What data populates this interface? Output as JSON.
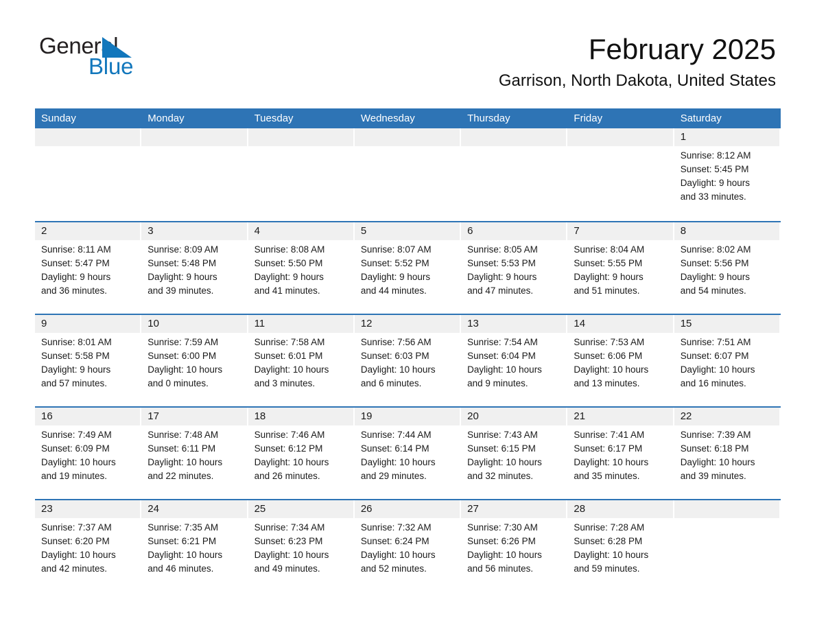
{
  "brand": {
    "name_part1": "General",
    "name_part2": "Blue",
    "triangle_color": "#1277bc",
    "text_color": "#231f20"
  },
  "header": {
    "title": "February 2025",
    "subtitle": "Garrison, North Dakota, United States"
  },
  "colors": {
    "header_blue": "#2e74b5",
    "day_band_gray": "#f0f0f0",
    "text": "#1a1a1a"
  },
  "weekday_headers": [
    "Sunday",
    "Monday",
    "Tuesday",
    "Wednesday",
    "Thursday",
    "Friday",
    "Saturday"
  ],
  "weeks": [
    [
      {
        "empty": true
      },
      {
        "empty": true
      },
      {
        "empty": true
      },
      {
        "empty": true
      },
      {
        "empty": true
      },
      {
        "empty": true
      },
      {
        "day": "1",
        "sunrise": "Sunrise: 8:12 AM",
        "sunset": "Sunset: 5:45 PM",
        "daylight_line1": "Daylight: 9 hours",
        "daylight_line2": "and 33 minutes."
      }
    ],
    [
      {
        "day": "2",
        "sunrise": "Sunrise: 8:11 AM",
        "sunset": "Sunset: 5:47 PM",
        "daylight_line1": "Daylight: 9 hours",
        "daylight_line2": "and 36 minutes."
      },
      {
        "day": "3",
        "sunrise": "Sunrise: 8:09 AM",
        "sunset": "Sunset: 5:48 PM",
        "daylight_line1": "Daylight: 9 hours",
        "daylight_line2": "and 39 minutes."
      },
      {
        "day": "4",
        "sunrise": "Sunrise: 8:08 AM",
        "sunset": "Sunset: 5:50 PM",
        "daylight_line1": "Daylight: 9 hours",
        "daylight_line2": "and 41 minutes."
      },
      {
        "day": "5",
        "sunrise": "Sunrise: 8:07 AM",
        "sunset": "Sunset: 5:52 PM",
        "daylight_line1": "Daylight: 9 hours",
        "daylight_line2": "and 44 minutes."
      },
      {
        "day": "6",
        "sunrise": "Sunrise: 8:05 AM",
        "sunset": "Sunset: 5:53 PM",
        "daylight_line1": "Daylight: 9 hours",
        "daylight_line2": "and 47 minutes."
      },
      {
        "day": "7",
        "sunrise": "Sunrise: 8:04 AM",
        "sunset": "Sunset: 5:55 PM",
        "daylight_line1": "Daylight: 9 hours",
        "daylight_line2": "and 51 minutes."
      },
      {
        "day": "8",
        "sunrise": "Sunrise: 8:02 AM",
        "sunset": "Sunset: 5:56 PM",
        "daylight_line1": "Daylight: 9 hours",
        "daylight_line2": "and 54 minutes."
      }
    ],
    [
      {
        "day": "9",
        "sunrise": "Sunrise: 8:01 AM",
        "sunset": "Sunset: 5:58 PM",
        "daylight_line1": "Daylight: 9 hours",
        "daylight_line2": "and 57 minutes."
      },
      {
        "day": "10",
        "sunrise": "Sunrise: 7:59 AM",
        "sunset": "Sunset: 6:00 PM",
        "daylight_line1": "Daylight: 10 hours",
        "daylight_line2": "and 0 minutes."
      },
      {
        "day": "11",
        "sunrise": "Sunrise: 7:58 AM",
        "sunset": "Sunset: 6:01 PM",
        "daylight_line1": "Daylight: 10 hours",
        "daylight_line2": "and 3 minutes."
      },
      {
        "day": "12",
        "sunrise": "Sunrise: 7:56 AM",
        "sunset": "Sunset: 6:03 PM",
        "daylight_line1": "Daylight: 10 hours",
        "daylight_line2": "and 6 minutes."
      },
      {
        "day": "13",
        "sunrise": "Sunrise: 7:54 AM",
        "sunset": "Sunset: 6:04 PM",
        "daylight_line1": "Daylight: 10 hours",
        "daylight_line2": "and 9 minutes."
      },
      {
        "day": "14",
        "sunrise": "Sunrise: 7:53 AM",
        "sunset": "Sunset: 6:06 PM",
        "daylight_line1": "Daylight: 10 hours",
        "daylight_line2": "and 13 minutes."
      },
      {
        "day": "15",
        "sunrise": "Sunrise: 7:51 AM",
        "sunset": "Sunset: 6:07 PM",
        "daylight_line1": "Daylight: 10 hours",
        "daylight_line2": "and 16 minutes."
      }
    ],
    [
      {
        "day": "16",
        "sunrise": "Sunrise: 7:49 AM",
        "sunset": "Sunset: 6:09 PM",
        "daylight_line1": "Daylight: 10 hours",
        "daylight_line2": "and 19 minutes."
      },
      {
        "day": "17",
        "sunrise": "Sunrise: 7:48 AM",
        "sunset": "Sunset: 6:11 PM",
        "daylight_line1": "Daylight: 10 hours",
        "daylight_line2": "and 22 minutes."
      },
      {
        "day": "18",
        "sunrise": "Sunrise: 7:46 AM",
        "sunset": "Sunset: 6:12 PM",
        "daylight_line1": "Daylight: 10 hours",
        "daylight_line2": "and 26 minutes."
      },
      {
        "day": "19",
        "sunrise": "Sunrise: 7:44 AM",
        "sunset": "Sunset: 6:14 PM",
        "daylight_line1": "Daylight: 10 hours",
        "daylight_line2": "and 29 minutes."
      },
      {
        "day": "20",
        "sunrise": "Sunrise: 7:43 AM",
        "sunset": "Sunset: 6:15 PM",
        "daylight_line1": "Daylight: 10 hours",
        "daylight_line2": "and 32 minutes."
      },
      {
        "day": "21",
        "sunrise": "Sunrise: 7:41 AM",
        "sunset": "Sunset: 6:17 PM",
        "daylight_line1": "Daylight: 10 hours",
        "daylight_line2": "and 35 minutes."
      },
      {
        "day": "22",
        "sunrise": "Sunrise: 7:39 AM",
        "sunset": "Sunset: 6:18 PM",
        "daylight_line1": "Daylight: 10 hours",
        "daylight_line2": "and 39 minutes."
      }
    ],
    [
      {
        "day": "23",
        "sunrise": "Sunrise: 7:37 AM",
        "sunset": "Sunset: 6:20 PM",
        "daylight_line1": "Daylight: 10 hours",
        "daylight_line2": "and 42 minutes."
      },
      {
        "day": "24",
        "sunrise": "Sunrise: 7:35 AM",
        "sunset": "Sunset: 6:21 PM",
        "daylight_line1": "Daylight: 10 hours",
        "daylight_line2": "and 46 minutes."
      },
      {
        "day": "25",
        "sunrise": "Sunrise: 7:34 AM",
        "sunset": "Sunset: 6:23 PM",
        "daylight_line1": "Daylight: 10 hours",
        "daylight_line2": "and 49 minutes."
      },
      {
        "day": "26",
        "sunrise": "Sunrise: 7:32 AM",
        "sunset": "Sunset: 6:24 PM",
        "daylight_line1": "Daylight: 10 hours",
        "daylight_line2": "and 52 minutes."
      },
      {
        "day": "27",
        "sunrise": "Sunrise: 7:30 AM",
        "sunset": "Sunset: 6:26 PM",
        "daylight_line1": "Daylight: 10 hours",
        "daylight_line2": "and 56 minutes."
      },
      {
        "day": "28",
        "sunrise": "Sunrise: 7:28 AM",
        "sunset": "Sunset: 6:28 PM",
        "daylight_line1": "Daylight: 10 hours",
        "daylight_line2": "and 59 minutes."
      },
      {
        "empty": true
      }
    ]
  ]
}
